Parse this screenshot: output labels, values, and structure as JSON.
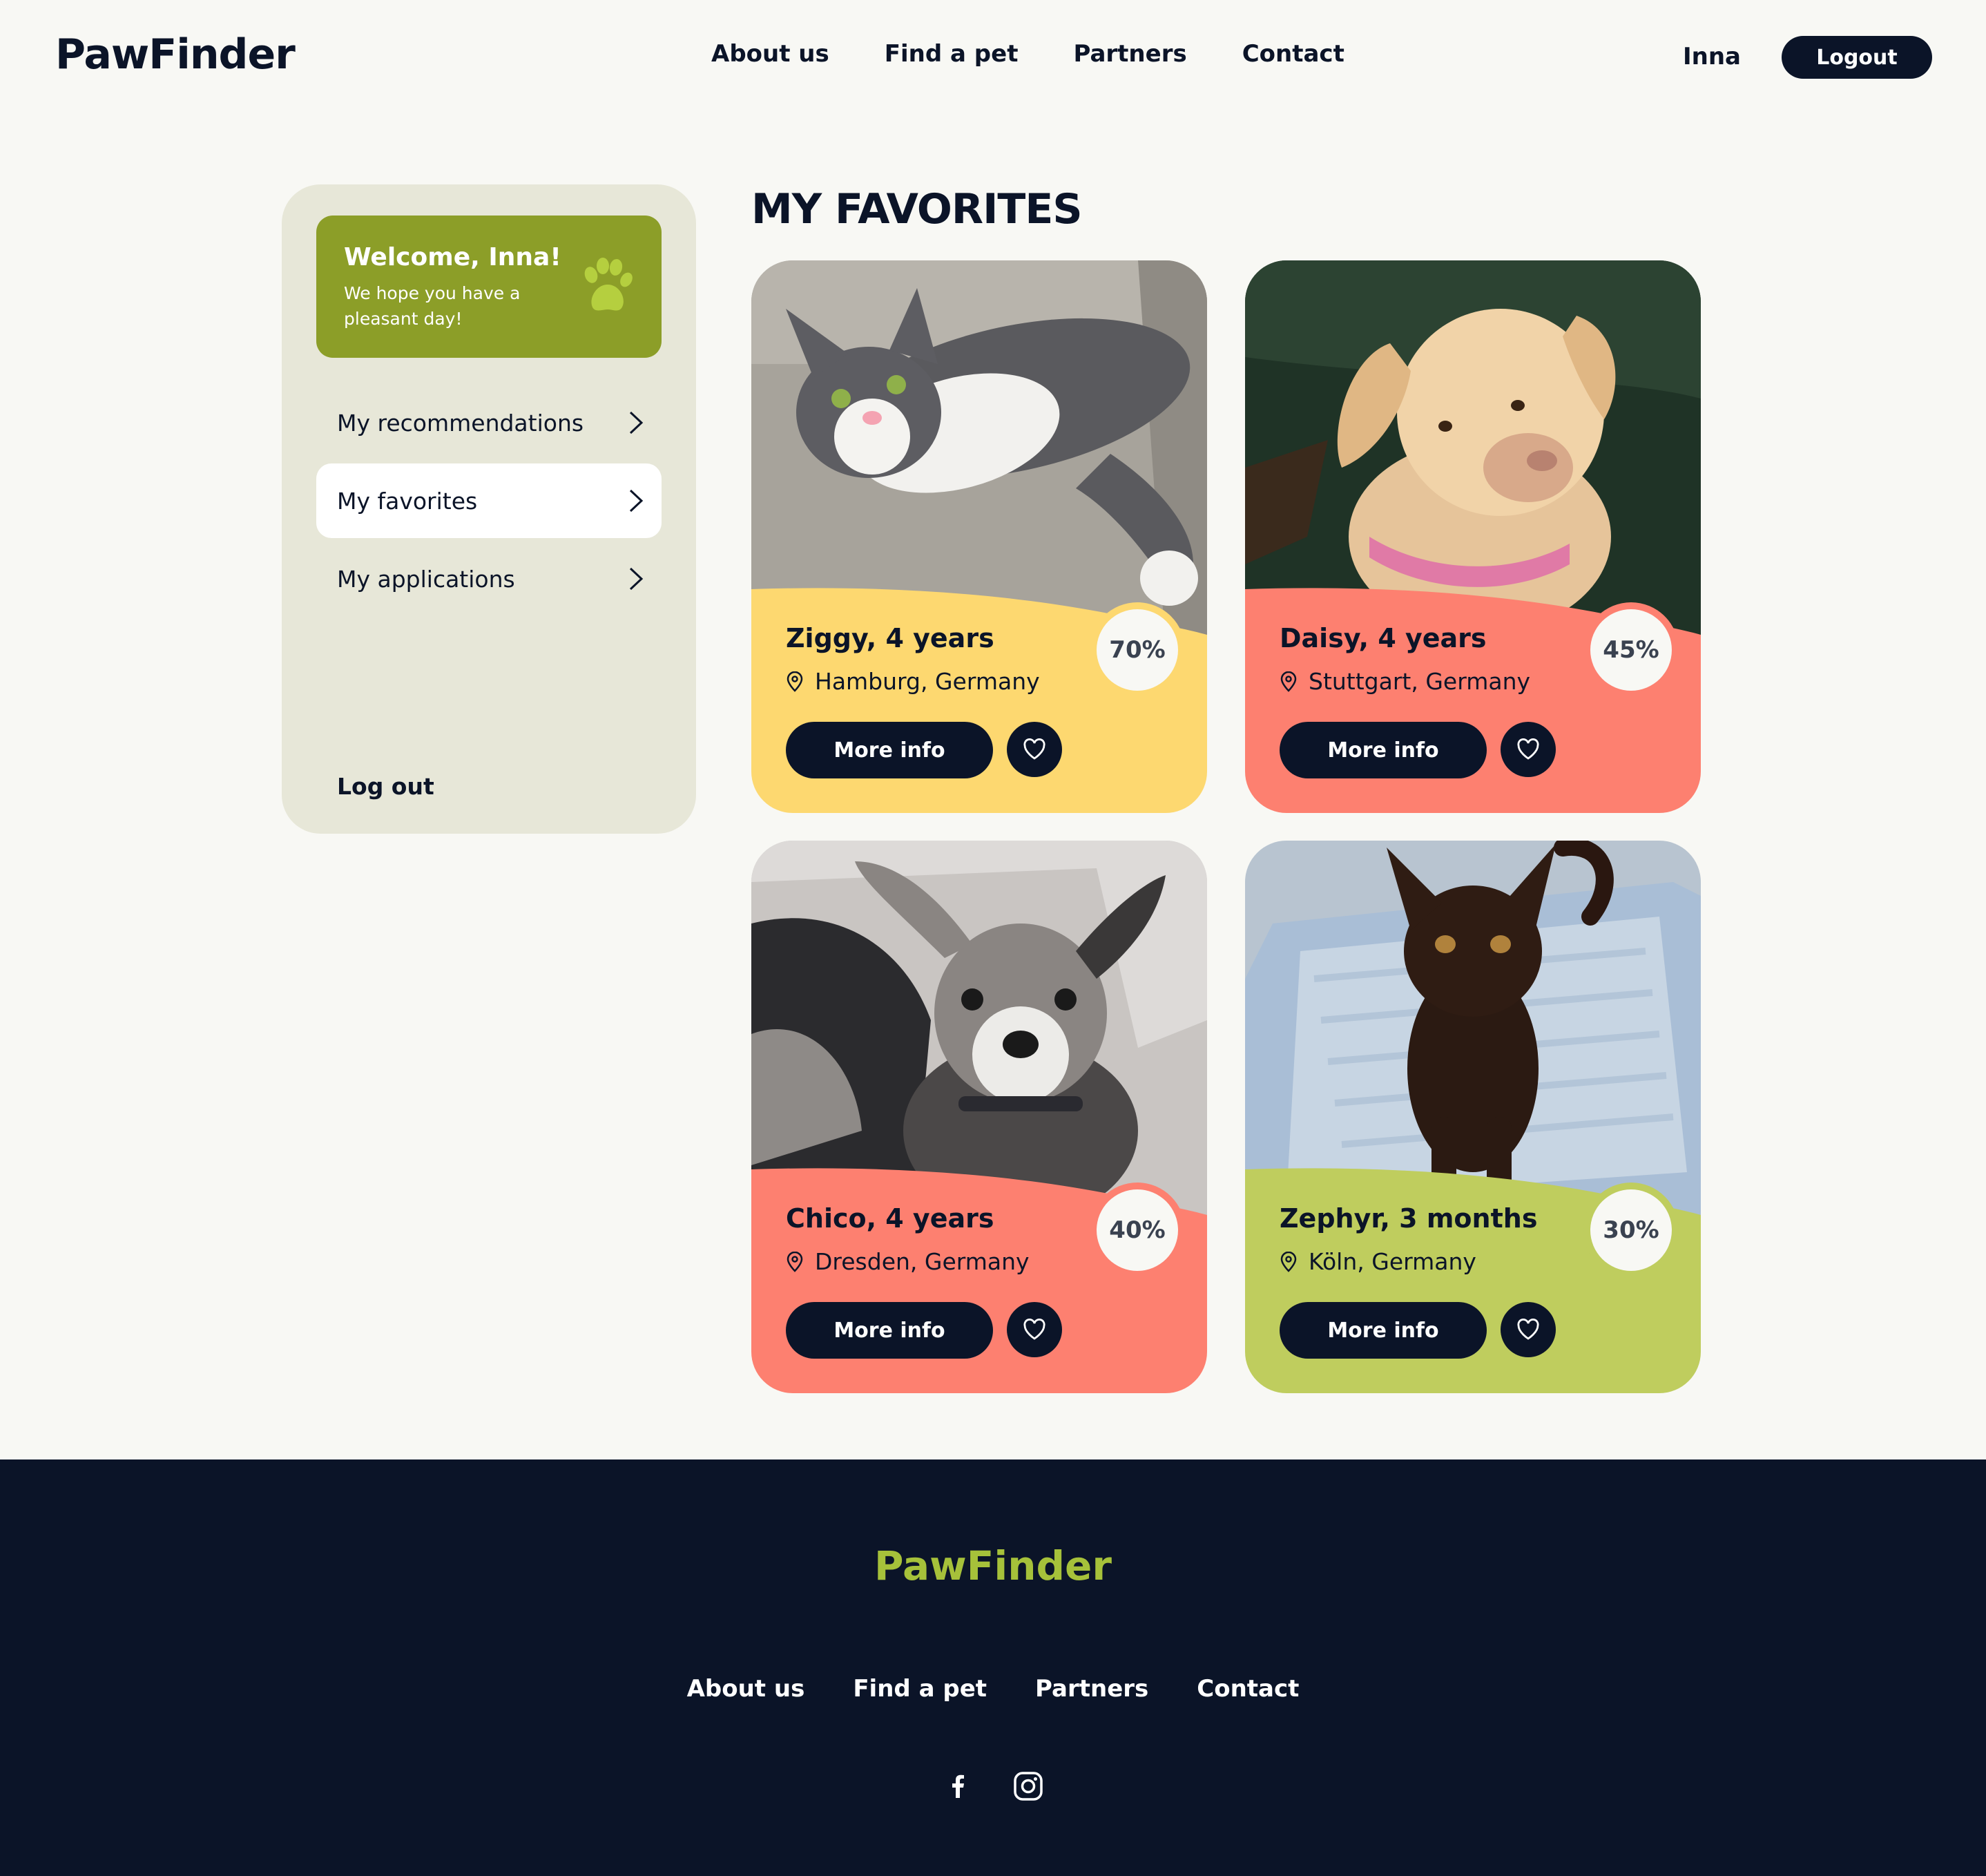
{
  "header": {
    "logo": "PawFinder",
    "nav": [
      "About us",
      "Find a pet",
      "Partners",
      "Contact"
    ],
    "user_name": "Inna",
    "logout_label": "Logout"
  },
  "sidebar": {
    "welcome_title": "Welcome, Inna!",
    "welcome_subtitle": "We hope you have a pleasant day!",
    "welcome_icon": "paw-icon",
    "items": [
      {
        "label": "My recommendations",
        "active": false,
        "icon": "chevron-right-icon"
      },
      {
        "label": "My favorites",
        "active": true,
        "icon": "chevron-right-icon"
      },
      {
        "label": "My applications",
        "active": false,
        "icon": "chevron-right-icon"
      }
    ],
    "logout_label": "Log out"
  },
  "main": {
    "title": "MY FAVORITES",
    "pets": [
      {
        "name": "Ziggy, 4 years",
        "location": "Hamburg, Germany",
        "match": "70%",
        "color": "#fdd870",
        "species": "cat",
        "more_label": "More info"
      },
      {
        "name": "Daisy, 4 years",
        "location": "Stuttgart, Germany",
        "match": "45%",
        "color": "#fd8070",
        "species": "dog",
        "more_label": "More info"
      },
      {
        "name": "Chico, 4 years",
        "location": "Dresden, Germany",
        "match": "40%",
        "color": "#fd8070",
        "species": "dog",
        "more_label": "More info"
      },
      {
        "name": "Zephyr, 3 months",
        "location": "Köln, Germany",
        "match": "30%",
        "color": "#bfcd5e",
        "species": "cat",
        "more_label": "More info"
      }
    ]
  },
  "footer": {
    "logo": "PawFinder",
    "nav": [
      "About us",
      "Find a pet",
      "Partners",
      "Contact"
    ],
    "socials": [
      "facebook-icon",
      "instagram-icon"
    ]
  },
  "colors": {
    "navy": "#0b1428",
    "olive": "#8c9e28",
    "sidebar_bg": "#e7e7d8",
    "footer_logo": "#a6c13a",
    "background": "#f8f8f4"
  }
}
